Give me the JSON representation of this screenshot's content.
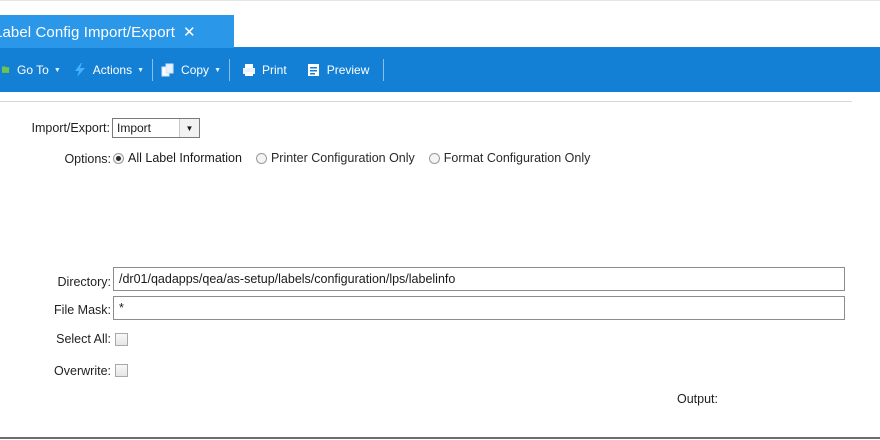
{
  "tab": {
    "title": "Label Config Import/Export",
    "close_glyph": "✕"
  },
  "toolbar": {
    "goto_label": "Go To",
    "actions_label": "Actions",
    "copy_label": "Copy",
    "print_label": "Print",
    "preview_label": "Preview"
  },
  "form": {
    "import_export_label": "Import/Export:",
    "import_export_value": "Import",
    "options_label": "Options:",
    "options": [
      {
        "label": "All Label Information",
        "selected": true
      },
      {
        "label": "Printer Configuration Only",
        "selected": false
      },
      {
        "label": "Format Configuration Only",
        "selected": false
      }
    ],
    "directory_label": "Directory:",
    "directory_value": "/dr01/qadapps/qea/as-setup/labels/configuration/lps/labelinfo",
    "file_mask_label": "File Mask:",
    "file_mask_value": "*",
    "select_all_label": "Select All:",
    "select_all_checked": false,
    "overwrite_label": "Overwrite:",
    "overwrite_checked": false,
    "output_label": "Output:"
  },
  "colors": {
    "tab_bg": "#2b97e8",
    "toolbar_bg": "#1380d6"
  }
}
